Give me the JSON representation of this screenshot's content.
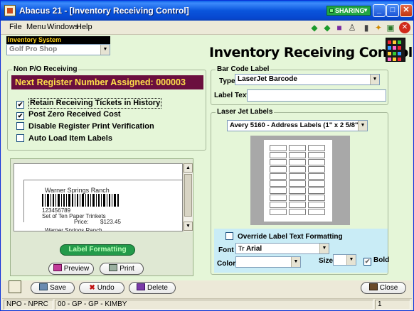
{
  "window": {
    "title": "Abacus 21 - [Inventory Receiving Control]",
    "sharing_label": "SHARING",
    "minimize_glyph": "_",
    "maximize_glyph": "□",
    "close_glyph": "✕"
  },
  "menu": [
    "File",
    "Menu",
    "Windows",
    "Help"
  ],
  "toolbar_icons": [
    "arrow-left-icon",
    "arrow-right-icon",
    "book-icon",
    "person-icon",
    "calculator-icon",
    "running-man-icon",
    "exit-door-icon",
    "stop-icon"
  ],
  "inventory_system": {
    "label": "Inventory System",
    "selected": "Golf Pro Shop"
  },
  "page_title": "Inventory Receiving Control",
  "non_po": {
    "title": "Non P/O Receiving",
    "next_register": "Next Register Number Assigned:  000003",
    "options": [
      {
        "label": "Retain Receiving Tickets in History",
        "checked": true
      },
      {
        "label": "Post Zero Received Cost",
        "checked": true
      },
      {
        "label": "Disable Register Print Verification",
        "checked": false
      },
      {
        "label": "Auto Load Item Labels",
        "checked": false
      }
    ]
  },
  "preview": {
    "line1": "Warner Springs Ranch",
    "barcode_number": "123456789",
    "description": "Set of Ten Paper Trinkets",
    "price_label": "Price:",
    "price": "$123.45",
    "cut_off": "Warner Springs Ranch"
  },
  "buttons": {
    "label_formatting": "Label Formatting",
    "preview": "Preview",
    "print": "Print",
    "save": "Save",
    "undo": "Undo",
    "delete": "Delete",
    "close": "Close"
  },
  "bar_code_label": {
    "title": "Bar Code Label",
    "type_label": "Type",
    "type_value": "LaserJet Barcode",
    "label_text_label": "Label Text",
    "label_text_value": ""
  },
  "laser_jet_labels": {
    "title": "Laser Jet Labels",
    "selected": "Avery 5160 - Address Labels (1\" x 2 5/8\")",
    "sheet_rows": 10,
    "sheet_cols": 3
  },
  "override": {
    "checkbox_label": "Override Label Text Formatting",
    "checked": false,
    "font_label": "Font",
    "font_value": "Arial",
    "color_label": "Color",
    "color_value": "",
    "size_label": "Size",
    "size_value": "",
    "bold_label": "Bold",
    "bold_checked": true
  },
  "status_bar": {
    "left": "NPO - NPRC",
    "middle": "00 - GP - GP - KIMBY",
    "right": "1"
  }
}
